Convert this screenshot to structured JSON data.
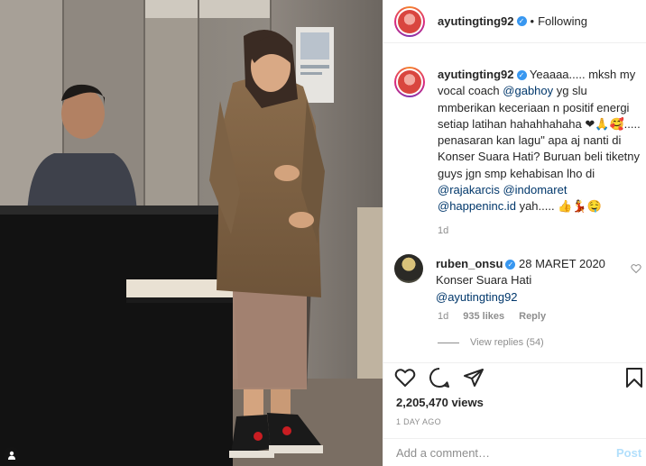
{
  "colors": {
    "accent": "#3897f0",
    "mention": "#00376b",
    "muted": "#8e8e8e",
    "border": "#efefef",
    "post_disabled": "#b2dffc"
  },
  "icons": {
    "avatar_btn": "user-icon",
    "like": "heart-icon",
    "comment": "comment-bubble-icon",
    "share": "paper-plane-icon",
    "save": "bookmark-icon",
    "verified": "verified-badge-icon"
  },
  "header": {
    "username": "ayutingting92",
    "separator": "•",
    "follow_status": "Following"
  },
  "caption": {
    "username": "ayutingting92",
    "parts": {
      "p1": "Yeaaaa..... mksh my vocal coach",
      "m1": "@gabhoy",
      "p2": "yg slu mmberikan keceriaan n positif energi setiap latihan hahahhahaha",
      "e1": "❤🙏🥰",
      "p3": "..... penasaran kan lagu\" apa aj nanti di Konser Suara Hati? Buruan beli tiketny guys jgn smp kehabisan lho di",
      "m2": "@rajakarcis",
      "m3": "@indomaret",
      "m4": "@happeninc.id",
      "p4": "yah.....",
      "e2": "👍💃🤤"
    },
    "age": "1d"
  },
  "comment": {
    "username": "ruben_onsu",
    "date_text": "28 MARET 2020",
    "text": "Konser Suara Hati",
    "mention": "@ayutingting92",
    "age": "1d",
    "likes": "935 likes",
    "reply": "Reply",
    "view_replies": "View replies (54)"
  },
  "stats": {
    "views": "2,205,470 views",
    "date": "1 DAY AGO"
  },
  "add_comment": {
    "placeholder": "Add a comment…",
    "post": "Post"
  }
}
